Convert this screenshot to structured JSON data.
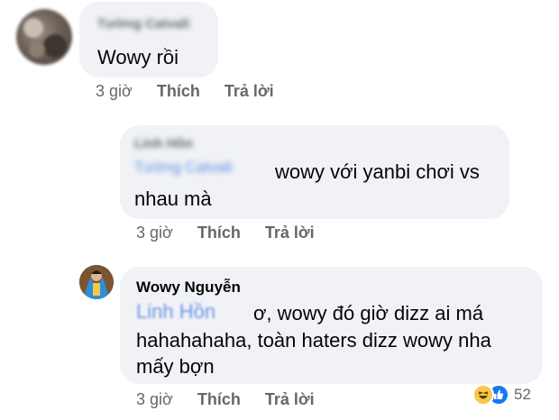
{
  "comments": [
    {
      "author": "Tường Catvali",
      "text": "Wowy rồi",
      "meta": {
        "time": "3 giờ",
        "like": "Thích",
        "reply": "Trả lời"
      }
    },
    {
      "author": "Linh Hồn",
      "mention": "Tường Catvali",
      "text_line1": "wowy với yanbi chơi vs",
      "text_line2": "nhau mà",
      "meta": {
        "time": "3 giờ",
        "like": "Thích",
        "reply": "Trả lời"
      }
    },
    {
      "author": "Wowy Nguyễn",
      "mention": "Linh Hồn",
      "text_line1": "ơ, wowy đó giờ dizz ai má",
      "text_line2": "hahahahaha, toàn haters dizz wowy nha",
      "text_line3": "mấy bợn",
      "meta": {
        "time": "3 giờ",
        "like": "Thích",
        "reply": "Trả lời"
      },
      "reactions": {
        "icons": [
          "haha-icon",
          "like-icon"
        ],
        "count": "52"
      }
    }
  ],
  "colors": {
    "bubble": "#f0f2f5",
    "meta": "#65676b",
    "mention": "#6b96e8",
    "like": "#1877f2",
    "haha": "#f7c84a"
  }
}
